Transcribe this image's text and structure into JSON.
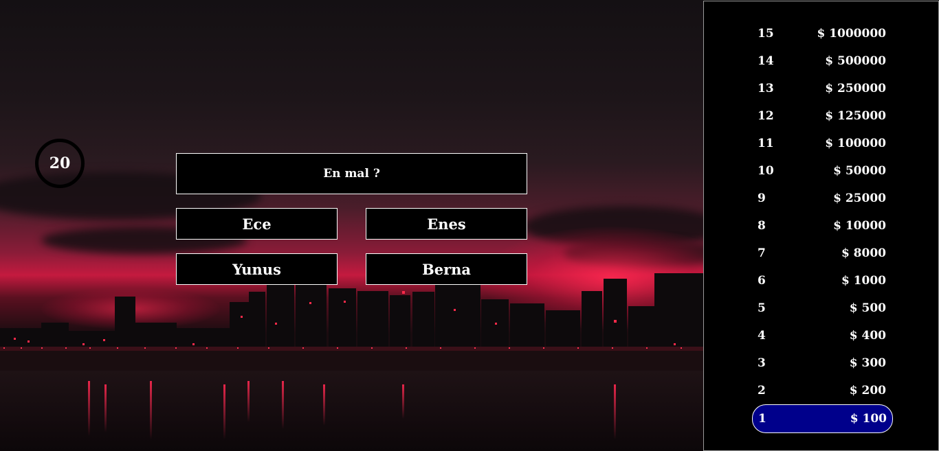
{
  "timer": {
    "value": "20"
  },
  "question": {
    "text": "En mal ?"
  },
  "answers": [
    {
      "label": "Ece"
    },
    {
      "label": "Enes"
    },
    {
      "label": "Yunus"
    },
    {
      "label": "Berna"
    }
  ],
  "ladder": [
    {
      "level": "15",
      "amount": "$ 1000000"
    },
    {
      "level": "14",
      "amount": "$ 500000"
    },
    {
      "level": "13",
      "amount": "$ 250000"
    },
    {
      "level": "12",
      "amount": "$ 125000"
    },
    {
      "level": "11",
      "amount": "$ 100000"
    },
    {
      "level": "10",
      "amount": "$ 50000"
    },
    {
      "level": "9",
      "amount": "$ 25000"
    },
    {
      "level": "8",
      "amount": "$ 10000"
    },
    {
      "level": "7",
      "amount": "$ 8000"
    },
    {
      "level": "6",
      "amount": "$ 1000"
    },
    {
      "level": "5",
      "amount": "$ 500"
    },
    {
      "level": "4",
      "amount": "$ 400"
    },
    {
      "level": "3",
      "amount": "$ 300"
    },
    {
      "level": "2",
      "amount": "$ 200"
    },
    {
      "level": "1",
      "amount": "$ 100"
    }
  ],
  "colors": {
    "active_level": "#00008b",
    "panel": "#000000",
    "text": "#ffffff"
  }
}
